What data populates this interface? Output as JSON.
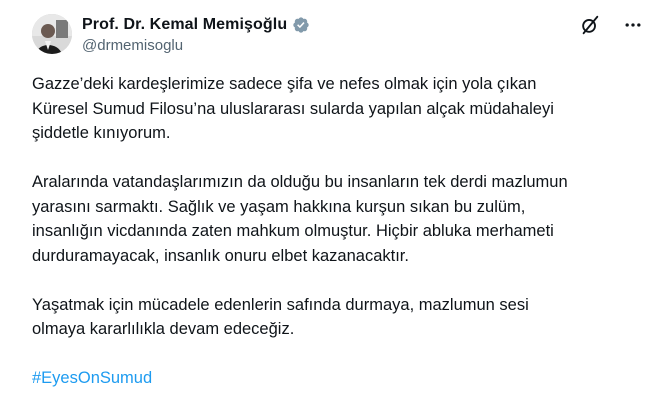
{
  "author": {
    "display_name": "Prof. Dr. Kemal Memişoğlu",
    "handle": "@drmemisoglu",
    "verified": true
  },
  "icons": {
    "verified": "verified-badge-icon",
    "grok": "grok-icon",
    "more": "more-options-icon"
  },
  "colors": {
    "text": "#0f1419",
    "secondary": "#536471",
    "link": "#1d9bf0",
    "verified_badge": "#829aab"
  },
  "tweet": {
    "paragraphs": [
      "Gazze’deki kardeşlerimize sadece şifa ve nefes olmak için yola çıkan\nKüresel Sumud Filosu’na uluslararası sularda yapılan alçak müdahaleyi\nşiddetle kınıyorum.",
      "Aralarında vatandaşlarımızın da olduğu bu insanların tek derdi mazlumun\nyarasını sarmaktı. Sağlık ve yaşam hakkına kurşun sıkan bu zulüm,\ninsanlığın vicdanında zaten mahkum olmuştur. Hiçbir abluka merhameti\ndurduramayacak, insanlık onuru elbet kazanacaktır.",
      "Yaşatmak için mücadele edenlerin safında durmaya, mazlumun sesi\nolmaya kararlılıkla devam edeceğiz."
    ],
    "hashtag": "#EyesOnSumud"
  }
}
